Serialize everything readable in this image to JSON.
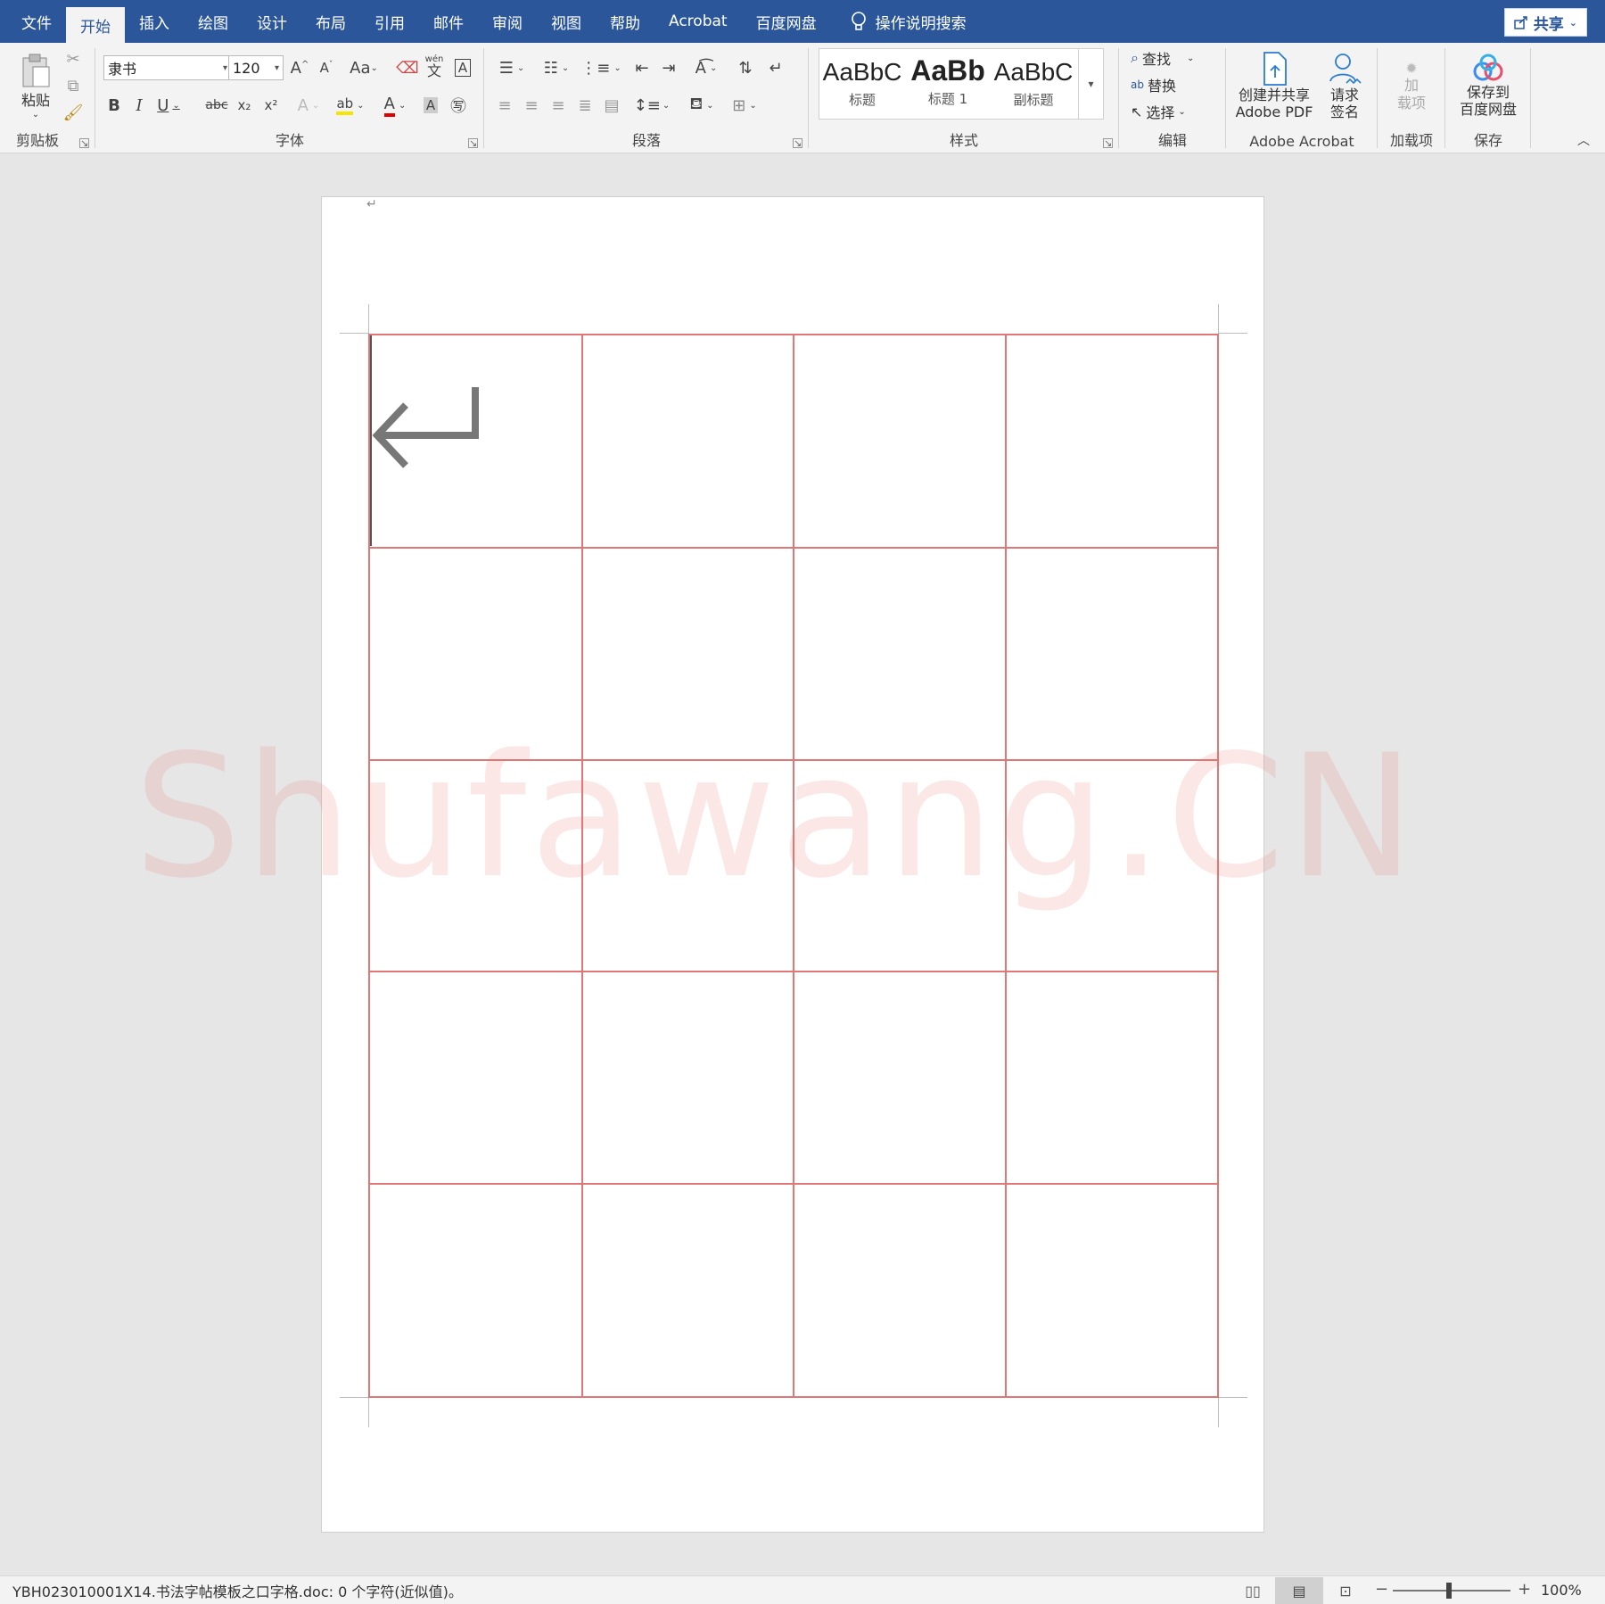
{
  "tabs": [
    "文件",
    "开始",
    "插入",
    "绘图",
    "设计",
    "布局",
    "引用",
    "邮件",
    "审阅",
    "视图",
    "帮助",
    "Acrobat",
    "百度网盘"
  ],
  "active_tab_index": 1,
  "tell_me": "操作说明搜索",
  "share": "共享",
  "ribbon": {
    "clipboard": {
      "paste": "粘贴",
      "label": "剪贴板"
    },
    "font": {
      "font_name": "隶书",
      "font_size": "120",
      "change_case": "Aa",
      "phonetic": "wén",
      "phonetic_char": "文",
      "bold": "B",
      "italic": "I",
      "underline": "U",
      "strike": "abc",
      "subscript": "x₂",
      "superscript": "x²",
      "label": "字体"
    },
    "paragraph": {
      "label": "段落"
    },
    "styles": {
      "items": [
        {
          "preview": "AaBbC",
          "name": "标题"
        },
        {
          "preview": "AaBb",
          "name": "标题 1"
        },
        {
          "preview": "AaBbC",
          "name": "副标题"
        }
      ],
      "label": "样式"
    },
    "editing": {
      "find": "查找",
      "replace": "替换",
      "select": "选择",
      "label": "编辑"
    },
    "acrobat": {
      "create_share_line1": "创建并共享",
      "create_share_line2": "Adobe PDF",
      "request_sign_line1": "请求",
      "request_sign_line2": "签名",
      "label": "Adobe Acrobat"
    },
    "addins": {
      "line1": "加",
      "line2": "载项",
      "label": "加载项"
    },
    "save": {
      "line1": "保存到",
      "line2": "百度网盘",
      "label": "保存"
    }
  },
  "document": {
    "grid_rows": 5,
    "grid_cols": 4,
    "grid_color": "#e07777",
    "watermark": "Shufawang.CN"
  },
  "status": {
    "text": "YBH023010001X14.书法字帖模板之口字格.doc: 0 个字符(近似值)。",
    "zoom": "100%"
  },
  "colors": {
    "accent": "#2b579a",
    "ribbon_bg": "#f3f3f3"
  }
}
